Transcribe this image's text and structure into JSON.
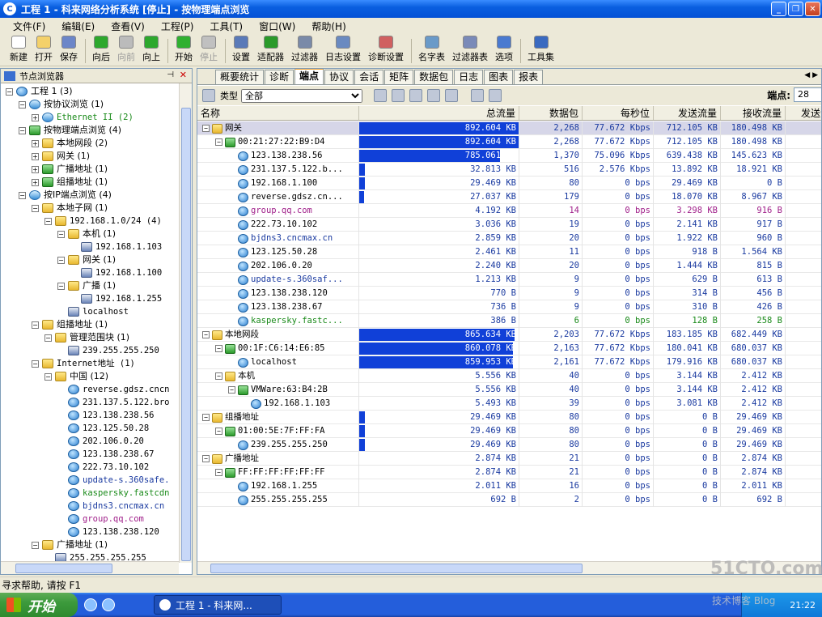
{
  "window": {
    "title": "工程 1 - 科来网络分析系统 [停止] - 按物理端点浏览"
  },
  "menu": [
    "文件(F)",
    "编辑(E)",
    "查看(V)",
    "工程(P)",
    "工具(T)",
    "窗口(W)",
    "帮助(H)"
  ],
  "toolbar": [
    {
      "label": "新建",
      "icon": "new-file-icon",
      "color": "#ffffff"
    },
    {
      "label": "打开",
      "icon": "open-folder-icon",
      "color": "#f4d16a"
    },
    {
      "label": "保存",
      "icon": "save-disk-icon",
      "color": "#6c86c8"
    },
    {
      "label": "向后",
      "icon": "back-arrow-icon",
      "color": "#2da82d"
    },
    {
      "label": "向前",
      "icon": "forward-arrow-icon",
      "color": "#bbbbbb",
      "disabled": true
    },
    {
      "label": "向上",
      "icon": "up-arrow-icon",
      "color": "#2da82d"
    },
    {
      "label": "开始",
      "icon": "start-icon",
      "color": "#30b030"
    },
    {
      "label": "停止",
      "icon": "stop-icon",
      "color": "#c0c0c0",
      "disabled": true
    },
    {
      "label": "设置",
      "icon": "settings-icon",
      "color": "#5a7ab8"
    },
    {
      "label": "适配器",
      "icon": "adapter-icon",
      "color": "#2a9a2a"
    },
    {
      "label": "过滤器",
      "icon": "filter-icon",
      "color": "#7a8aa8"
    },
    {
      "label": "日志设置",
      "icon": "log-settings-icon",
      "color": "#6a8ac0"
    },
    {
      "label": "诊断设置",
      "icon": "diagnosis-settings-icon",
      "color": "#d06060"
    },
    {
      "label": "名字表",
      "icon": "name-table-icon",
      "color": "#6a9ac8"
    },
    {
      "label": "过滤器表",
      "icon": "filter-table-icon",
      "color": "#7a8ab8"
    },
    {
      "label": "选项",
      "icon": "options-icon",
      "color": "#4a7ad0"
    },
    {
      "label": "工具集",
      "icon": "toolset-icon",
      "color": "#3a6ac0"
    }
  ],
  "left_panel": {
    "title": "节点浏览器",
    "tree": [
      {
        "t": "工程 1 (3)",
        "l": 0,
        "e": "-",
        "i": "globe"
      },
      {
        "t": "按协议浏览 (1)",
        "l": 1,
        "e": "-",
        "i": "net"
      },
      {
        "t": "Ethernet II (2)",
        "l": 2,
        "e": "+",
        "i": "net",
        "c": "g"
      },
      {
        "t": "按物理端点浏览 (4)",
        "l": 1,
        "e": "-",
        "i": "green"
      },
      {
        "t": "本地网段 (2)",
        "l": 2,
        "e": "+",
        "i": "folder"
      },
      {
        "t": "网关 (1)",
        "l": 2,
        "e": "+",
        "i": "folder"
      },
      {
        "t": "广播地址 (1)",
        "l": 2,
        "e": "+",
        "i": "green"
      },
      {
        "t": "组播地址 (1)",
        "l": 2,
        "e": "+",
        "i": "green"
      },
      {
        "t": "按IP端点浏览 (4)",
        "l": 1,
        "e": "-",
        "i": "net"
      },
      {
        "t": "本地子网 (1)",
        "l": 2,
        "e": "-",
        "i": "folder"
      },
      {
        "t": "192.168.1.0/24 (4)",
        "l": 3,
        "e": "-",
        "i": "folder"
      },
      {
        "t": "本机 (1)",
        "l": 4,
        "e": "-",
        "i": "folder"
      },
      {
        "t": "192.168.1.103",
        "l": 5,
        "i": "pc"
      },
      {
        "t": "网关 (1)",
        "l": 4,
        "e": "-",
        "i": "folder"
      },
      {
        "t": "192.168.1.100",
        "l": 5,
        "i": "pc"
      },
      {
        "t": "广播 (1)",
        "l": 4,
        "e": "-",
        "i": "folder"
      },
      {
        "t": "192.168.1.255",
        "l": 5,
        "i": "pc"
      },
      {
        "t": "localhost",
        "l": 4,
        "i": "pc"
      },
      {
        "t": "组播地址 (1)",
        "l": 2,
        "e": "-",
        "i": "folder"
      },
      {
        "t": "管理范围块 (1)",
        "l": 3,
        "e": "-",
        "i": "folder"
      },
      {
        "t": "239.255.255.250",
        "l": 4,
        "i": "pc"
      },
      {
        "t": "Internet地址 (1)",
        "l": 2,
        "e": "-",
        "i": "folder"
      },
      {
        "t": "中国 (12)",
        "l": 3,
        "e": "-",
        "i": "folder"
      },
      {
        "t": "reverse.gdsz.cncn",
        "l": 4,
        "i": "globe"
      },
      {
        "t": "231.137.5.122.bro",
        "l": 4,
        "i": "globe"
      },
      {
        "t": "123.138.238.56",
        "l": 4,
        "i": "globe"
      },
      {
        "t": "123.125.50.28",
        "l": 4,
        "i": "globe"
      },
      {
        "t": "202.106.0.20",
        "l": 4,
        "i": "globe"
      },
      {
        "t": "123.138.238.67",
        "l": 4,
        "i": "globe"
      },
      {
        "t": "222.73.10.102",
        "l": 4,
        "i": "globe"
      },
      {
        "t": "update-s.360safe.",
        "l": 4,
        "i": "globe",
        "c": "b"
      },
      {
        "t": "kaspersky.fastcdn",
        "l": 4,
        "i": "globe",
        "c": "g"
      },
      {
        "t": "bjdns3.cncmax.cn",
        "l": 4,
        "i": "globe",
        "c": "b"
      },
      {
        "t": "group.qq.com",
        "l": 4,
        "i": "globe",
        "c": "p"
      },
      {
        "t": "123.138.238.120",
        "l": 4,
        "i": "globe"
      },
      {
        "t": "广播地址 (1)",
        "l": 2,
        "e": "-",
        "i": "folder"
      },
      {
        "t": "255.255.255.255",
        "l": 3,
        "i": "pc"
      }
    ]
  },
  "tabs": [
    "概要统计",
    "诊断",
    "端点",
    "协议",
    "会话",
    "矩阵",
    "数据包",
    "日志",
    "图表",
    "报表"
  ],
  "active_tab": "端点",
  "filter": {
    "label": "类型",
    "value": "全部",
    "count_label": "端点:",
    "count_value": "28"
  },
  "columns": [
    "名称",
    "总流量",
    "数据包",
    "每秒位",
    "发送流量",
    "接收流量",
    "发送流"
  ],
  "rows": [
    {
      "l": 0,
      "e": "-",
      "i": "folder",
      "name": "网关",
      "total": "892.604 KB",
      "ratio": 1.0,
      "pk": "2,268",
      "bps": "77.672 Kbps",
      "tx": "712.105 KB",
      "rx": "180.498 KB",
      "sel": true
    },
    {
      "l": 1,
      "e": "-",
      "i": "green",
      "name": "00:21:27:22:B9:D4",
      "total": "892.604 KB",
      "ratio": 1.0,
      "pk": "2,268",
      "bps": "77.672 Kbps",
      "tx": "712.105 KB",
      "rx": "180.498 KB"
    },
    {
      "l": 2,
      "i": "globe",
      "name": "123.138.238.56",
      "total": "785.061 KB",
      "ratio": 0.88,
      "pk": "1,370",
      "bps": "75.096 Kbps",
      "tx": "639.438 KB",
      "rx": "145.623 KB"
    },
    {
      "l": 2,
      "i": "globe",
      "name": "231.137.5.122.b...",
      "total": "32.813 KB",
      "ratio": 0.037,
      "pk": "516",
      "bps": "2.576 Kbps",
      "tx": "13.892 KB",
      "rx": "18.921 KB"
    },
    {
      "l": 2,
      "i": "globe",
      "name": "192.168.1.100",
      "total": "29.469 KB",
      "ratio": 0.033,
      "pk": "80",
      "bps": "0 bps",
      "tx": "29.469 KB",
      "rx": "0 B"
    },
    {
      "l": 2,
      "i": "globe",
      "name": "reverse.gdsz.cn...",
      "total": "27.037 KB",
      "ratio": 0.03,
      "pk": "179",
      "bps": "0 bps",
      "tx": "18.070 KB",
      "rx": "8.967 KB"
    },
    {
      "l": 2,
      "i": "globe",
      "name": "group.qq.com",
      "total": "4.192 KB",
      "ratio": 0.0,
      "pk": "14",
      "bps": "0 bps",
      "tx": "3.298 KB",
      "rx": "916 B",
      "c": "p"
    },
    {
      "l": 2,
      "i": "globe",
      "name": "222.73.10.102",
      "total": "3.036 KB",
      "ratio": 0.0,
      "pk": "19",
      "bps": "0 bps",
      "tx": "2.141 KB",
      "rx": "917 B"
    },
    {
      "l": 2,
      "i": "globe",
      "name": "bjdns3.cncmax.cn",
      "total": "2.859 KB",
      "ratio": 0.0,
      "pk": "20",
      "bps": "0 bps",
      "tx": "1.922 KB",
      "rx": "960 B",
      "c": "b"
    },
    {
      "l": 2,
      "i": "globe",
      "name": "123.125.50.28",
      "total": "2.461 KB",
      "ratio": 0.0,
      "pk": "11",
      "bps": "0 bps",
      "tx": "918 B",
      "rx": "1.564 KB"
    },
    {
      "l": 2,
      "i": "globe",
      "name": "202.106.0.20",
      "total": "2.240 KB",
      "ratio": 0.0,
      "pk": "20",
      "bps": "0 bps",
      "tx": "1.444 KB",
      "rx": "815 B"
    },
    {
      "l": 2,
      "i": "globe",
      "name": "update-s.360saf...",
      "total": "1.213 KB",
      "ratio": 0.0,
      "pk": "9",
      "bps": "0 bps",
      "tx": "629 B",
      "rx": "613 B",
      "c": "b"
    },
    {
      "l": 2,
      "i": "globe",
      "name": "123.138.238.120",
      "total": "770 B",
      "ratio": 0.0,
      "pk": "9",
      "bps": "0 bps",
      "tx": "314 B",
      "rx": "456 B"
    },
    {
      "l": 2,
      "i": "globe",
      "name": "123.138.238.67",
      "total": "736 B",
      "ratio": 0.0,
      "pk": "9",
      "bps": "0 bps",
      "tx": "310 B",
      "rx": "426 B"
    },
    {
      "l": 2,
      "i": "globe",
      "name": "kaspersky.fastc...",
      "total": "386 B",
      "ratio": 0.0,
      "pk": "6",
      "bps": "0 bps",
      "tx": "128 B",
      "rx": "258 B",
      "c": "g"
    },
    {
      "l": 0,
      "e": "-",
      "i": "folder",
      "name": "本地网段",
      "total": "865.634 KB",
      "ratio": 0.97,
      "pk": "2,203",
      "bps": "77.672 Kbps",
      "tx": "183.185 KB",
      "rx": "682.449 KB"
    },
    {
      "l": 1,
      "e": "-",
      "i": "green",
      "name": "00:1F:C6:14:E6:85",
      "total": "860.078 KB",
      "ratio": 0.96,
      "pk": "2,163",
      "bps": "77.672 Kbps",
      "tx": "180.041 KB",
      "rx": "680.037 KB"
    },
    {
      "l": 2,
      "i": "globe",
      "name": "localhost",
      "total": "859.953 KB",
      "ratio": 0.96,
      "pk": "2,161",
      "bps": "77.672 Kbps",
      "tx": "179.916 KB",
      "rx": "680.037 KB"
    },
    {
      "l": 1,
      "e": "-",
      "i": "folder",
      "name": "本机",
      "total": "5.556 KB",
      "ratio": 0.0,
      "pk": "40",
      "bps": "0 bps",
      "tx": "3.144 KB",
      "rx": "2.412 KB"
    },
    {
      "l": 2,
      "e": "-",
      "i": "green",
      "name": "VMWare:63:B4:2B",
      "total": "5.556 KB",
      "ratio": 0.0,
      "pk": "40",
      "bps": "0 bps",
      "tx": "3.144 KB",
      "rx": "2.412 KB"
    },
    {
      "l": 3,
      "i": "globe",
      "name": "192.168.1.103",
      "total": "5.493 KB",
      "ratio": 0.0,
      "pk": "39",
      "bps": "0 bps",
      "tx": "3.081 KB",
      "rx": "2.412 KB"
    },
    {
      "l": 0,
      "e": "-",
      "i": "folder",
      "name": "组播地址",
      "total": "29.469 KB",
      "ratio": 0.033,
      "pk": "80",
      "bps": "0 bps",
      "tx": "0 B",
      "rx": "29.469 KB"
    },
    {
      "l": 1,
      "e": "-",
      "i": "green",
      "name": "01:00:5E:7F:FF:FA",
      "total": "29.469 KB",
      "ratio": 0.033,
      "pk": "80",
      "bps": "0 bps",
      "tx": "0 B",
      "rx": "29.469 KB"
    },
    {
      "l": 2,
      "i": "globe",
      "name": "239.255.255.250",
      "total": "29.469 KB",
      "ratio": 0.033,
      "pk": "80",
      "bps": "0 bps",
      "tx": "0 B",
      "rx": "29.469 KB"
    },
    {
      "l": 0,
      "e": "-",
      "i": "folder",
      "name": "广播地址",
      "total": "2.874 KB",
      "ratio": 0.0,
      "pk": "21",
      "bps": "0 bps",
      "tx": "0 B",
      "rx": "2.874 KB"
    },
    {
      "l": 1,
      "e": "-",
      "i": "green",
      "name": "FF:FF:FF:FF:FF:FF",
      "total": "2.874 KB",
      "ratio": 0.0,
      "pk": "21",
      "bps": "0 bps",
      "tx": "0 B",
      "rx": "2.874 KB"
    },
    {
      "l": 2,
      "i": "globe",
      "name": "192.168.1.255",
      "total": "2.011 KB",
      "ratio": 0.0,
      "pk": "16",
      "bps": "0 bps",
      "tx": "0 B",
      "rx": "2.011 KB"
    },
    {
      "l": 2,
      "i": "globe",
      "name": "255.255.255.255",
      "total": "692 B",
      "ratio": 0.0,
      "pk": "2",
      "bps": "0 bps",
      "tx": "0 B",
      "rx": "692 B"
    }
  ],
  "status": "寻求帮助, 请按 F1",
  "taskbar": {
    "start": "开始",
    "task": "工程 1 - 科来网...",
    "time": "21:22"
  },
  "watermark": {
    "site": "51CTO.com",
    "sub": "技术博客 Blog"
  }
}
